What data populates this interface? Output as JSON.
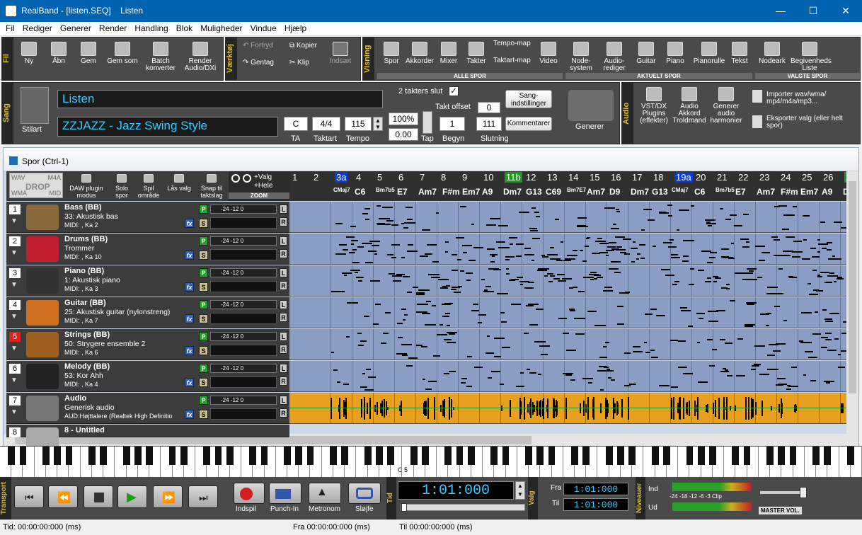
{
  "window": {
    "title": "RealBand - [listen.SEQ]    Listen",
    "min": "—",
    "max": "☐",
    "close": "✕"
  },
  "menu": [
    "Fil",
    "Rediger",
    "Generer",
    "Render",
    "Handling",
    "Blok",
    "Muligheder",
    "Vindue",
    "Hjælp"
  ],
  "toolbar": {
    "fil_label": "Fil",
    "vaerktoj_label": "Værktøj",
    "visning_label": "Visning",
    "fil": [
      {
        "label": "Ny"
      },
      {
        "label": "Åbn"
      },
      {
        "label": "Gem"
      },
      {
        "label": "Gem som"
      },
      {
        "label": "Batch konverter"
      },
      {
        "label": "Render Audio/DXi"
      }
    ],
    "tools": {
      "fortryd": "Fortryd",
      "gentag": "Gentag",
      "kopier": "Kopier",
      "klip": "Klip",
      "indsaet": "Indsæt"
    },
    "view_all": [
      {
        "label": "Spor"
      },
      {
        "label": "Akkorder"
      },
      {
        "label": "Mixer"
      },
      {
        "label": "Takter"
      },
      {
        "label": "Tempo-map"
      },
      {
        "label": "Taktart-map"
      },
      {
        "label": "Video"
      }
    ],
    "view_current": [
      {
        "label": "Node-system"
      },
      {
        "label": "Audio-rediger"
      },
      {
        "label": "Guitar"
      },
      {
        "label": "Piano"
      },
      {
        "label": "Pianorulle"
      },
      {
        "label": "Tekst"
      }
    ],
    "view_selected": [
      {
        "label": "Nodeark"
      },
      {
        "label": "Begivenheds Liste"
      }
    ],
    "band_all": "ALLE SPOR",
    "band_current": "AKTUELT SPOR",
    "band_selected": "VALGTE SPOR"
  },
  "song": {
    "label": "Sang",
    "stilart": "Stilart",
    "title": "Listen",
    "style": "ZZJAZZ - Jazz Swing Style",
    "two_bar_end": "2 takters slut",
    "takt_offset": "Takt offset",
    "takt_offset_val": "0",
    "key": "C",
    "key_lbl": "TA",
    "time_sig": "4/4",
    "time_lbl": "Taktart",
    "tempo": "115",
    "tempo_lbl": "Tempo",
    "percent": "100%",
    "zero": "0.00",
    "tap": "Tap",
    "begin": "1",
    "begin_lbl": "Begyn",
    "end": "111",
    "end_lbl": "Slutning",
    "settings_btn": "Sang-indstillinger",
    "comments_btn": "Kommentarer",
    "generate": "Generer"
  },
  "audio": {
    "label": "Audio",
    "vst": "VST/DX Plugins (effekter)",
    "chord_wiz": "Audio Akkord Troldmand",
    "harmony": "Generer audio harmonier",
    "import": "Importer wav/wma/ mp4/m4a/mp3...",
    "export": "Eksporter valg (eller helt spor)"
  },
  "spor": {
    "title": "Spor (Ctrl-1)",
    "wav": "WAV",
    "m4a": "M4A",
    "drop": "DROP",
    "wma": "WMA",
    "mid": "MID",
    "dxi": "DAW plugin modus",
    "solo": "Solo spor",
    "spil": "Spil område",
    "laas": "Lås valg",
    "snap": "Snap til taktslag",
    "valg": "+Valg",
    "hele": "+Hele",
    "zoom": "ZOOM",
    "bars": [
      "1",
      "2",
      "3a",
      "4",
      "5",
      "6",
      "7",
      "8",
      "9",
      "10",
      "11b",
      "12",
      "13",
      "14",
      "15",
      "16",
      "17",
      "18",
      "19a",
      "20",
      "21",
      "22",
      "23",
      "24",
      "25",
      "26",
      "2"
    ],
    "chords": [
      "CMaj7",
      "C6",
      "Bm7b5",
      "E7",
      "Am7",
      "F#m",
      "Em7",
      "A9",
      "Dm7",
      "G13",
      "C69",
      "Bm7E7",
      "Am7",
      "D9",
      "Dm7",
      "G13",
      "CMaj7",
      "C6",
      "Bm7b5",
      "E7",
      "Am7",
      "F#m",
      "Em7",
      "A9",
      "D"
    ],
    "tracks": [
      {
        "num": "1",
        "name": "Bass   (BB)",
        "inst": "33: Akustisk bas",
        "midi": "MIDI: , Ka 2"
      },
      {
        "num": "2",
        "name": "Drums   (BB)",
        "inst": "Trommer",
        "midi": "MIDI: , Ka 10"
      },
      {
        "num": "3",
        "name": "Piano   (BB)",
        "inst": "1: Akustisk piano",
        "midi": "MIDI: , Ka 3"
      },
      {
        "num": "4",
        "name": "Guitar   (BB)",
        "inst": "25: Akustisk guitar (nylonstreng)",
        "midi": "MIDI: , Ka 7"
      },
      {
        "num": "5",
        "name": "Strings   (BB)",
        "inst": "50: Strygere ensemble 2",
        "midi": "MIDI: , Ka 6"
      },
      {
        "num": "6",
        "name": "Melody   (BB)",
        "inst": "53: Kor Ahh",
        "midi": "MIDI: , Ka 4"
      },
      {
        "num": "7",
        "name": "Audio",
        "inst": "Generisk audio",
        "midi": "AUD:Højttalere (Realtek High Definitio"
      },
      {
        "num": "8",
        "name": "8 - Untitled",
        "inst": "",
        "midi": ""
      }
    ],
    "p": "P",
    "s": "S",
    "fx": "fx",
    "l": "L",
    "r": "R",
    "level": "-24  -12    0"
  },
  "keyboard": {
    "c5": "C 5"
  },
  "transport": {
    "label": "Transport",
    "tid": "Tid",
    "valg": "Valg",
    "niveauer": "Niveauer",
    "rec": "Indspil",
    "punch": "Punch-In",
    "metronome": "Metronom",
    "loop": "Sløjfe",
    "time": "1:01:000",
    "fra": "Fra",
    "til": "Til",
    "fra_val": "1:01:000",
    "til_val": "1:01:000",
    "ind": "Ind",
    "ud": "Ud",
    "scale": "-24   -18   -12    -6  -3  Clip",
    "master": "MASTER VOL."
  },
  "status": {
    "tid": "Tid: 00:00:00:000 (ms)",
    "fra": "Fra 00:00:00:000 (ms)",
    "til": "Til 00:00:00:000 (ms)"
  }
}
